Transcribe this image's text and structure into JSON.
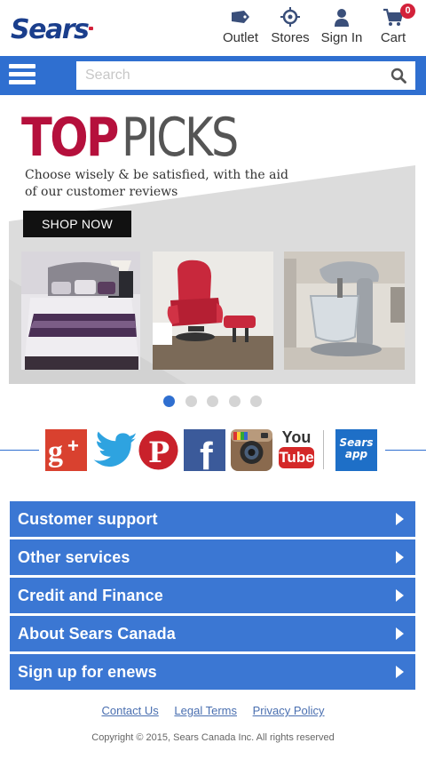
{
  "header": {
    "logo_text": "Sears",
    "nav": [
      {
        "label": "Outlet",
        "icon": "outlet-tag-icon"
      },
      {
        "label": "Stores",
        "icon": "store-locator-icon"
      },
      {
        "label": "Sign In",
        "icon": "user-icon"
      },
      {
        "label": "Cart",
        "icon": "cart-icon"
      }
    ],
    "cart_count": "0"
  },
  "search": {
    "placeholder": "Search",
    "value": ""
  },
  "banner": {
    "title_top": "TOP",
    "title_picks": "PICKS",
    "tagline": "Choose wisely & be satisfied, with the aid of our customer reviews",
    "cta_label": "SHOP NOW",
    "products": [
      "bedding-set",
      "red-recliner-chair",
      "stand-mixer"
    ]
  },
  "carousel": {
    "slide_count": 5,
    "active_index": 0
  },
  "social": [
    {
      "name": "Google+",
      "icon": "google-plus-icon"
    },
    {
      "name": "Twitter",
      "icon": "twitter-icon"
    },
    {
      "name": "Pinterest",
      "icon": "pinterest-icon"
    },
    {
      "name": "Facebook",
      "icon": "facebook-icon"
    },
    {
      "name": "Instagram",
      "icon": "instagram-icon"
    },
    {
      "name": "YouTube",
      "icon": "youtube-icon",
      "text_top": "You",
      "text_bottom": "Tube"
    },
    {
      "name": "Sears app",
      "icon": "sears-app-icon",
      "text_top": "Sears",
      "text_bottom": "app"
    }
  ],
  "accordion": [
    {
      "label": "Customer support"
    },
    {
      "label": "Other services"
    },
    {
      "label": "Credit and Finance"
    },
    {
      "label": "About Sears Canada"
    },
    {
      "label": "Sign up for enews"
    }
  ],
  "footer": {
    "links": [
      "Contact Us",
      "Legal Terms",
      "Privacy Policy"
    ],
    "copyright": "Copyright © 2015, Sears Canada Inc. All rights reserved"
  },
  "colors": {
    "brand_blue": "#2f6fd0",
    "accordion_blue": "#3b77d3",
    "logo_blue": "#1a3e8c",
    "top_red": "#b5103c",
    "badge_red": "#d3213a"
  }
}
